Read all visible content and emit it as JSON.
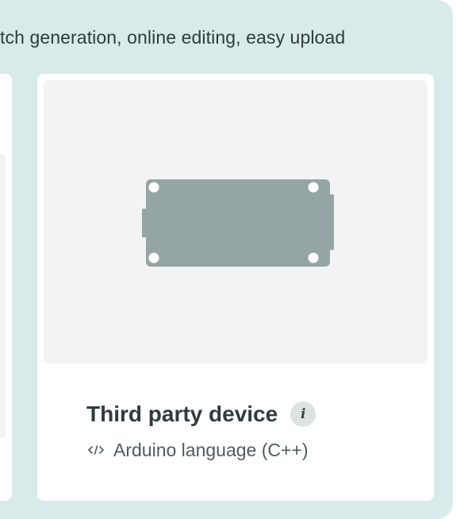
{
  "header": {
    "subtitle": "tch generation, online editing, easy upload"
  },
  "device_card": {
    "title": "Third party device",
    "language": "Arduino language (C++)",
    "info_icon": "info-icon",
    "language_icon": "code-icon",
    "image_icon": "circuit-board-icon"
  },
  "colors": {
    "panel_background": "#d9eaea",
    "card_background": "#ffffff",
    "image_background": "#f3f3f3",
    "board_color": "#95a5a6",
    "title_color": "#2f3b3f",
    "muted_text": "#4f5b5f"
  }
}
